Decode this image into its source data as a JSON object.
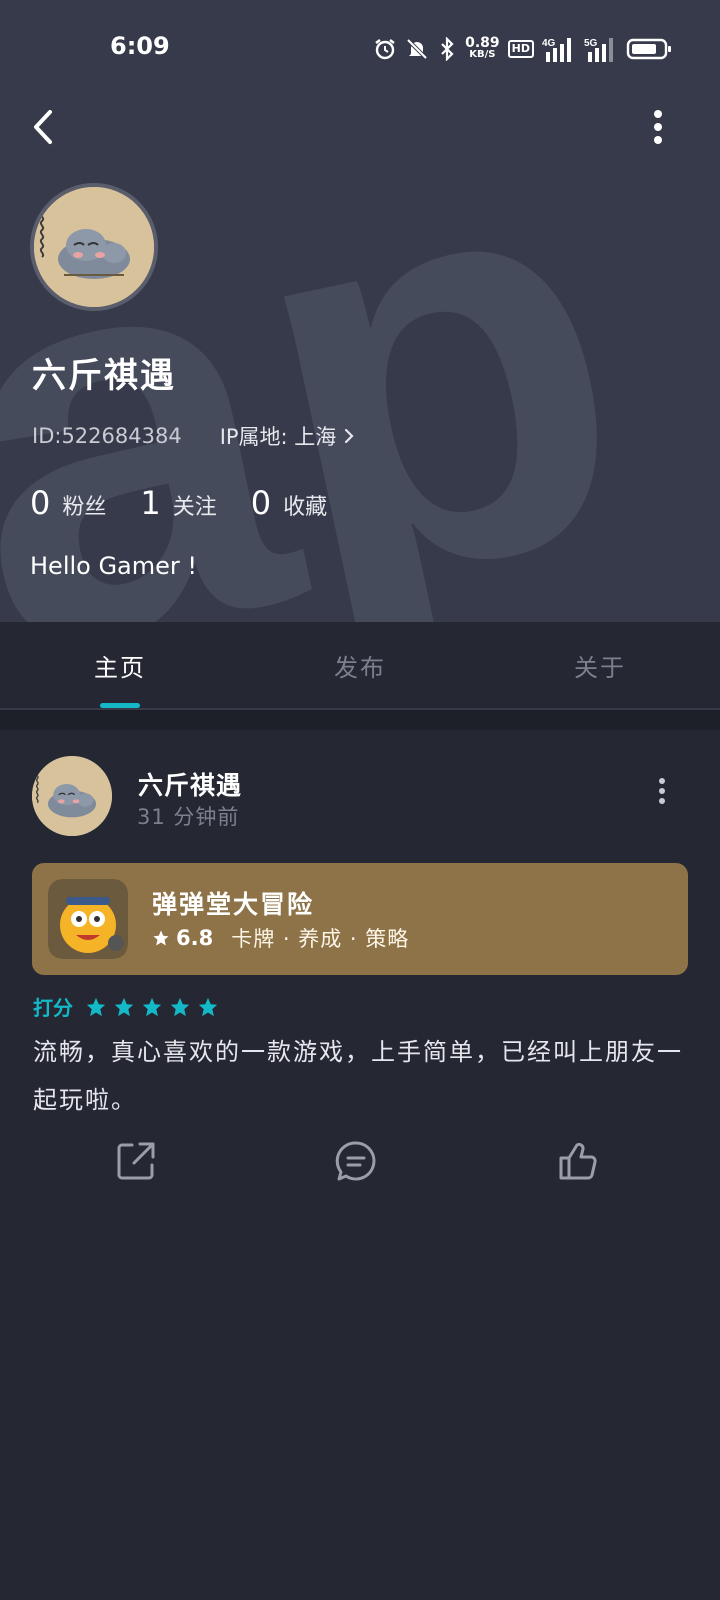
{
  "status_bar": {
    "time": "6:09",
    "net_speed_value": "0.89",
    "net_speed_unit": "KB/S",
    "hd_badge": "HD",
    "signal_1": "4G",
    "signal_2": "5G"
  },
  "profile": {
    "name": "六斤祺遇",
    "id_text": "ID:522684384",
    "ip_text": "IP属地: 上海",
    "stats": [
      {
        "count": "0",
        "label": "粉丝"
      },
      {
        "count": "1",
        "label": "关注"
      },
      {
        "count": "0",
        "label": "收藏"
      }
    ],
    "bio": "Hello Gamer !"
  },
  "tabs": [
    {
      "label": "主页",
      "active": true
    },
    {
      "label": "发布",
      "active": false
    },
    {
      "label": "关于",
      "active": false
    }
  ],
  "post": {
    "author": "六斤祺遇",
    "time_ago": "31 分钟前",
    "game": {
      "title": "弹弹堂大冒险",
      "rating": "6.8",
      "tags": "卡牌 · 养成 · 策略"
    },
    "score_label": "打分",
    "score_stars": 5,
    "review": "流畅，真心喜欢的一款游戏，上手简单，已经叫上朋友一起玩啦。"
  },
  "colors": {
    "header_bg": "#363a4a",
    "page_bg": "#252733",
    "accent": "#14b9c8",
    "game_card_bg": "#8e7348"
  }
}
